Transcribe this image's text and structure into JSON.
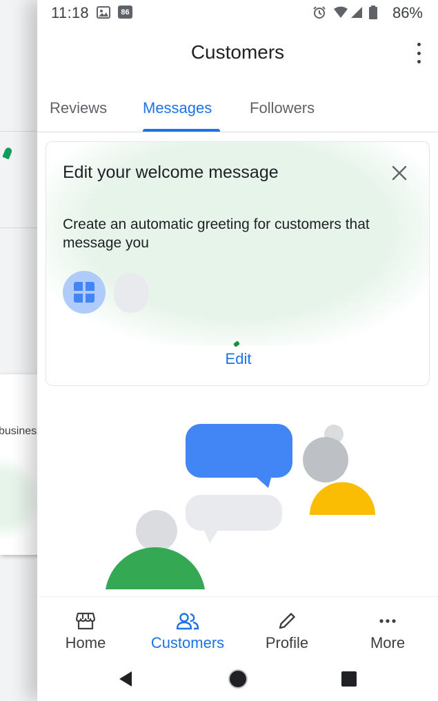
{
  "status_bar": {
    "time": "11:18",
    "notification_badge": "86",
    "battery": "86%"
  },
  "app_bar": {
    "title": "Customers",
    "overflow_icon": "more-vert-icon"
  },
  "tabs": [
    {
      "label": "Reviews",
      "active": false
    },
    {
      "label": "Messages",
      "active": true
    },
    {
      "label": "Followers",
      "active": false
    }
  ],
  "welcome_card": {
    "title": "Edit your welcome message",
    "description": "Create an automatic greeting for customers that message you",
    "edit_label": "Edit",
    "close_icon": "close-icon"
  },
  "background_screen": {
    "partial_text": "business"
  },
  "bottom_nav": [
    {
      "label": "Home",
      "icon": "storefront-icon",
      "active": false
    },
    {
      "label": "Customers",
      "icon": "people-icon",
      "active": true
    },
    {
      "label": "Profile",
      "icon": "pencil-icon",
      "active": false
    },
    {
      "label": "More",
      "icon": "more-horiz-icon",
      "active": false
    }
  ],
  "colors": {
    "accent": "#1a73e8",
    "illustration_blue": "#4285f4",
    "illustration_green": "#34a853",
    "illustration_yellow": "#fbbc04",
    "illustration_grey": "#dadce0"
  }
}
